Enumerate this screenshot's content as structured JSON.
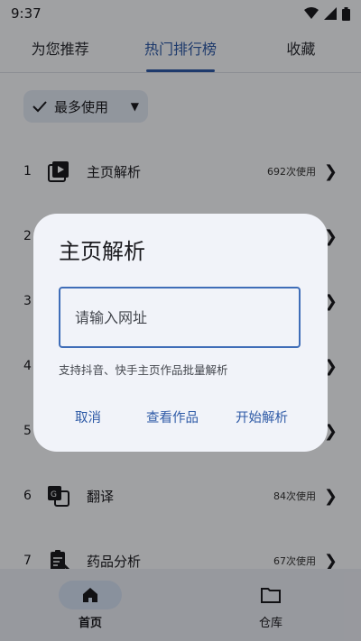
{
  "status_bar": {
    "time": "9:37"
  },
  "tabs": [
    {
      "label": "为您推荐",
      "active": false
    },
    {
      "label": "热门排行榜",
      "active": true
    },
    {
      "label": "收藏",
      "active": false
    }
  ],
  "filter": {
    "label": "最多使用",
    "check_icon": "check-icon",
    "caret_icon": "dropdown-caret-icon"
  },
  "list": {
    "rows": [
      {
        "index": "1",
        "name": "主页解析",
        "usage": "692次使用",
        "icon": "play-library-icon"
      },
      {
        "index": "2",
        "name": "",
        "usage": "",
        "icon": ""
      },
      {
        "index": "3",
        "name": "",
        "usage": "",
        "icon": ""
      },
      {
        "index": "4",
        "name": "",
        "usage": "",
        "icon": ""
      },
      {
        "index": "5",
        "name": "",
        "usage": "",
        "icon": ""
      },
      {
        "index": "6",
        "name": "翻译",
        "usage": "84次使用",
        "icon": "translate-icon"
      },
      {
        "index": "7",
        "name": "药品分析",
        "usage": "67次使用",
        "icon": "clipboard-medical-icon"
      }
    ]
  },
  "bottom_nav": [
    {
      "label": "首页",
      "icon": "home-icon",
      "active": true
    },
    {
      "label": "仓库",
      "icon": "folder-icon",
      "active": false
    }
  ],
  "dialog": {
    "title": "主页解析",
    "input_placeholder": "请输入网址",
    "input_value": "",
    "hint": "支持抖音、快手主页作品批量解析",
    "cancel_label": "取消",
    "view_label": "查看作品",
    "start_label": "开始解析"
  },
  "colors": {
    "accent": "#2e5aa6",
    "input_border": "#3f6db8",
    "chip_bg": "#dfe6f2",
    "dialog_bg": "#f1f3f9",
    "nav_bg": "#e9ebf3"
  }
}
